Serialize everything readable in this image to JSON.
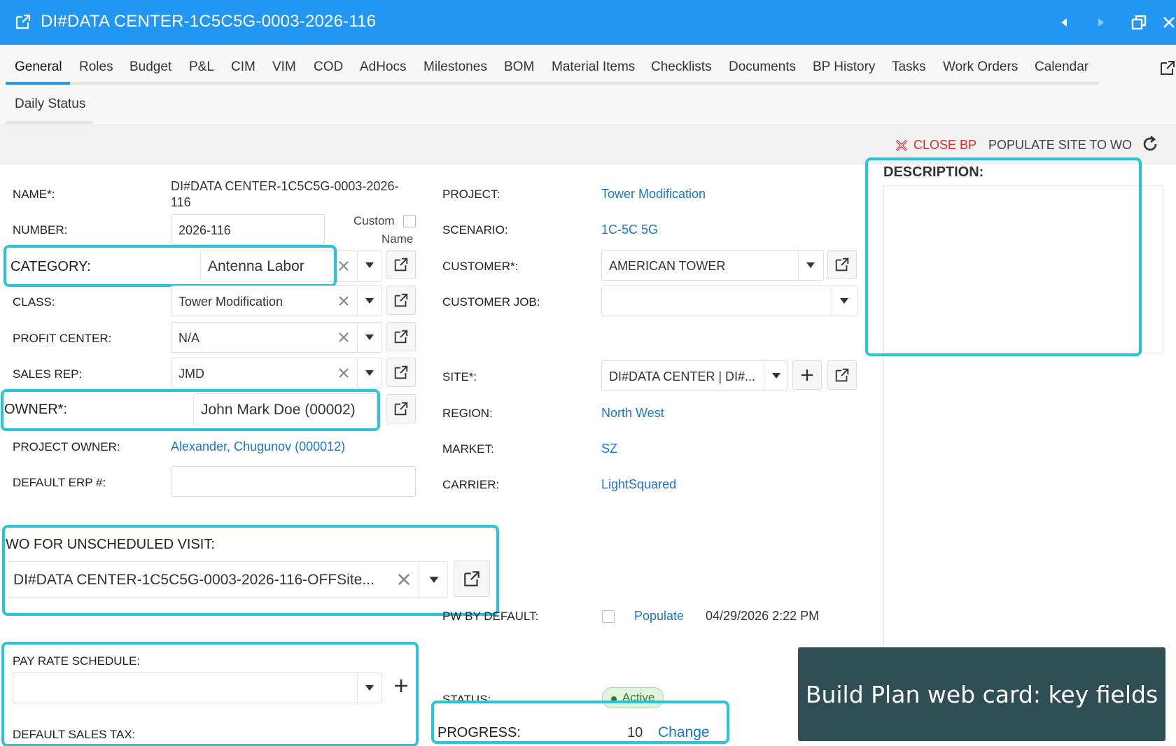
{
  "window": {
    "title": "DI#DATA CENTER-1C5C5G-0003-2026-116",
    "icons": [
      "external-link-icon",
      "prev-icon",
      "next-icon",
      "restore-icon",
      "close-icon"
    ]
  },
  "tabs": [
    {
      "label": "General",
      "active": true
    },
    {
      "label": "Roles"
    },
    {
      "label": "Budget"
    },
    {
      "label": "P&L"
    },
    {
      "label": "CIM"
    },
    {
      "label": "VIM"
    },
    {
      "label": "COD"
    },
    {
      "label": "AdHocs"
    },
    {
      "label": "Milestones"
    },
    {
      "label": "BOM"
    },
    {
      "label": "Material Items"
    },
    {
      "label": "Checklists"
    },
    {
      "label": "Documents"
    },
    {
      "label": "BP History"
    },
    {
      "label": "Tasks"
    },
    {
      "label": "Work Orders"
    },
    {
      "label": "Calendar"
    },
    {
      "label": "Daily Status"
    }
  ],
  "actions": {
    "close_bp": "CLOSE BP",
    "populate_site": "POPULATE SITE TO WO",
    "close_bp_color": "#d32f2f"
  },
  "left": {
    "name_label": "NAME*:",
    "name_value_line1": "DI#DATA CENTER-1C5C5G-0003-2026-",
    "name_value_line2": "116",
    "number_label": "NUMBER:",
    "number_value": "2026-116",
    "custom_name_line1": "Custom",
    "custom_name_line2": "Name",
    "category_label": "CATEGORY:",
    "category_value": "Antenna Labor",
    "class_label": "CLASS:",
    "class_value": "Tower Modification",
    "profit_center_label": "PROFIT CENTER:",
    "profit_center_value": "N/A",
    "sales_rep_label": "SALES REP:",
    "sales_rep_value": "JMD",
    "owner_label": "OWNER*:",
    "owner_value": "John Mark Doe (00002)",
    "project_owner_label": "PROJECT OWNER:",
    "project_owner_value": "Alexander, Chugunov (000012)",
    "default_erp_label": "DEFAULT ERP #:",
    "default_erp_value": "",
    "wo_unscheduled_label": "WO FOR UNSCHEDULED VISIT:",
    "wo_unscheduled_value": "DI#DATA CENTER-1C5C5G-0003-2026-116-OFFSite...",
    "pay_rate_label": "PAY RATE SCHEDULE:",
    "pay_rate_value": "",
    "default_sales_tax_label": "DEFAULT SALES TAX:"
  },
  "right": {
    "project_label": "PROJECT:",
    "project_value": "Tower Modification",
    "scenario_label": "SCENARIO:",
    "scenario_value": "1C-5C 5G",
    "customer_label": "CUSTOMER*:",
    "customer_value": "AMERICAN TOWER",
    "customer_job_label": "CUSTOMER JOB:",
    "customer_job_value": "",
    "site_label": "SITE*:",
    "site_value": "DI#DATA CENTER | DI#...",
    "region_label": "REGION:",
    "region_value": "North West",
    "market_label": "MARKET:",
    "market_value": "SZ",
    "carrier_label": "CARRIER:",
    "carrier_value": "LightSquared",
    "pw_default_label": "PW BY DEFAULT:",
    "populate_link": "Populate",
    "populate_timestamp": "04/29/2026 2:22 PM",
    "status_label": "STATUS:",
    "status_value": "Active",
    "progress_label": "PROGRESS:",
    "progress_value": "10",
    "progress_change": "Change"
  },
  "description": {
    "label": "DESCRIPTION:",
    "value": ""
  },
  "caption": "Build Plan web card: key fields",
  "colors": {
    "titlebar": "#2196f3",
    "highlight": "#26c6da",
    "link": "#1976d2",
    "caption_bg": "#2f4f55"
  }
}
